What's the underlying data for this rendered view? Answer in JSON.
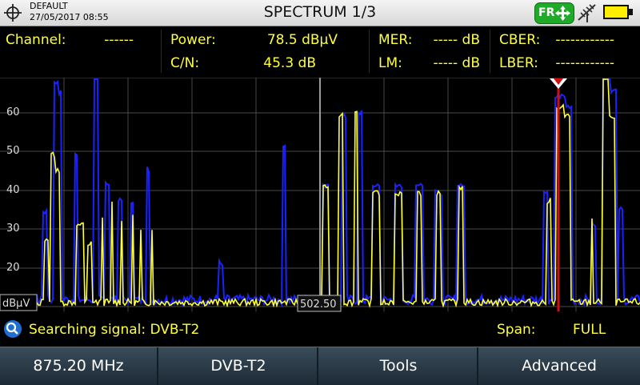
{
  "header": {
    "profile": "DEFAULT",
    "datetime": "27/05/2017 08:55",
    "title": "SPECTRUM 1/3",
    "fr_label": "FR"
  },
  "icons": {
    "locator": "crosshair-icon",
    "fr_button": "dpad-arrows-icon",
    "antenna": "antenna-icon",
    "battery": "battery-icon",
    "search": "magnifier-icon"
  },
  "measurements": {
    "channel": {
      "label": "Channel:",
      "value": "------"
    },
    "power": {
      "label": "Power:",
      "value": "78.5 dBµV"
    },
    "cn": {
      "label": "C/N:",
      "value": "45.3 dB"
    },
    "mer": {
      "label": "MER:",
      "value": "----- dB"
    },
    "lm": {
      "label": "LM:",
      "value": "----- dB"
    },
    "cber": {
      "label": "CBER:",
      "value": "------------"
    },
    "lber": {
      "label": "LBER:",
      "value": "------------"
    }
  },
  "spectrum": {
    "y_ticks": [
      "60",
      "50",
      "40",
      "30",
      "20"
    ],
    "y_unit": "dBµV",
    "center_label": "502.50",
    "colors": {
      "trace_live": "#ffff33",
      "trace_max": "#1a22ff",
      "marker": "#d01010",
      "grid": "#4a4a4a"
    }
  },
  "status": {
    "search_text": "Searching signal: DVB-T2",
    "span_label": "Span:",
    "span_value": "FULL"
  },
  "softkeys": [
    "875.20 MHz",
    "DVB-T2",
    "Tools",
    "Advanced"
  ],
  "colors": {
    "text_accent": "#ffff40",
    "fr_green": "#1faa2a",
    "battery_yellow": "#ffee00"
  }
}
